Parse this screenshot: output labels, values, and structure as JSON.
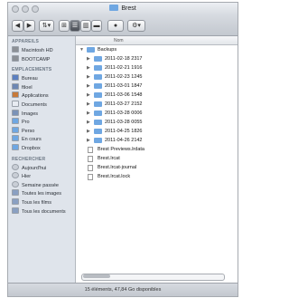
{
  "window": {
    "title": "Brest"
  },
  "toolbar": {
    "back_label": "◀",
    "forward_label": "▶",
    "view_icons_label": "⊞",
    "view_list_label": "☰",
    "view_columns_label": "▥",
    "view_coverflow_label": "▬",
    "eye_label": "●",
    "action_label": "⚙▾"
  },
  "sidebar": {
    "sections": [
      {
        "title": "APPAREILS",
        "items": [
          {
            "label": "Macintosh HD",
            "icon": "hard-drive-icon",
            "color": "#8c9096"
          },
          {
            "label": "BOOTCAMP",
            "icon": "hard-drive-icon",
            "color": "#8c9096"
          }
        ]
      },
      {
        "title": "EMPLACEMENTS",
        "items": [
          {
            "label": "Bureau",
            "icon": "desktop-icon",
            "color": "#5b7fc0"
          },
          {
            "label": "ftloel",
            "icon": "home-icon",
            "color": "#6d87b3"
          },
          {
            "label": "Applications",
            "icon": "applications-icon",
            "color": "#c77a3a"
          },
          {
            "label": "Documents",
            "icon": "documents-icon",
            "color": "#e8ecf2"
          },
          {
            "label": "Images",
            "icon": "pictures-icon",
            "color": "#7b93b8"
          },
          {
            "label": "Pro",
            "icon": "folder-icon",
            "color": "#6fa7e2"
          },
          {
            "label": "Perso",
            "icon": "folder-icon",
            "color": "#6fa7e2"
          },
          {
            "label": "En cours",
            "icon": "folder-icon",
            "color": "#6fa7e2"
          },
          {
            "label": "Dropbox",
            "icon": "folder-icon",
            "color": "#6fa7e2"
          }
        ]
      },
      {
        "title": "RECHERCHER",
        "items": [
          {
            "label": "Aujourd'hui",
            "icon": "clock-icon",
            "color": "#c9ced6"
          },
          {
            "label": "Hier",
            "icon": "clock-icon",
            "color": "#c9ced6"
          },
          {
            "label": "Semaine passée",
            "icon": "clock-icon",
            "color": "#c9ced6"
          },
          {
            "label": "Toutes les images",
            "icon": "smart-folder-icon",
            "color": "#8aa0c2"
          },
          {
            "label": "Tous les films",
            "icon": "smart-folder-icon",
            "color": "#8aa0c2"
          },
          {
            "label": "Tous les documents",
            "icon": "smart-folder-icon",
            "color": "#8aa0c2"
          }
        ]
      }
    ]
  },
  "list": {
    "column_header": "Nom",
    "rows": [
      {
        "name": "Backups",
        "kind": "folder",
        "indent": 0,
        "expanded": true
      },
      {
        "name": "2011-02-18 2317",
        "kind": "folder",
        "indent": 1,
        "expanded": false
      },
      {
        "name": "2011-02-21 1916",
        "kind": "folder",
        "indent": 1,
        "expanded": false
      },
      {
        "name": "2011-02-23 1245",
        "kind": "folder",
        "indent": 1,
        "expanded": false
      },
      {
        "name": "2011-03-01 1847",
        "kind": "folder",
        "indent": 1,
        "expanded": false
      },
      {
        "name": "2011-03-06 1548",
        "kind": "folder",
        "indent": 1,
        "expanded": false
      },
      {
        "name": "2011-03-27 2152",
        "kind": "folder",
        "indent": 1,
        "expanded": false
      },
      {
        "name": "2011-03-28 0006",
        "kind": "folder",
        "indent": 1,
        "expanded": false
      },
      {
        "name": "2011-03-28 0055",
        "kind": "folder",
        "indent": 1,
        "expanded": false
      },
      {
        "name": "2011-04-25 1826",
        "kind": "folder",
        "indent": 1,
        "expanded": false
      },
      {
        "name": "2011-04-26 2142",
        "kind": "folder",
        "indent": 1,
        "expanded": false
      },
      {
        "name": "Brest Previews.lrdata",
        "kind": "file",
        "indent": 0
      },
      {
        "name": "Brest.lrcat",
        "kind": "file",
        "indent": 0
      },
      {
        "name": "Brest.lrcat-journal",
        "kind": "file",
        "indent": 0
      },
      {
        "name": "Brest.lrcat.lock",
        "kind": "file",
        "indent": 0
      }
    ]
  },
  "statusbar": {
    "text": "15 éléments, 47,84 Go disponibles"
  }
}
